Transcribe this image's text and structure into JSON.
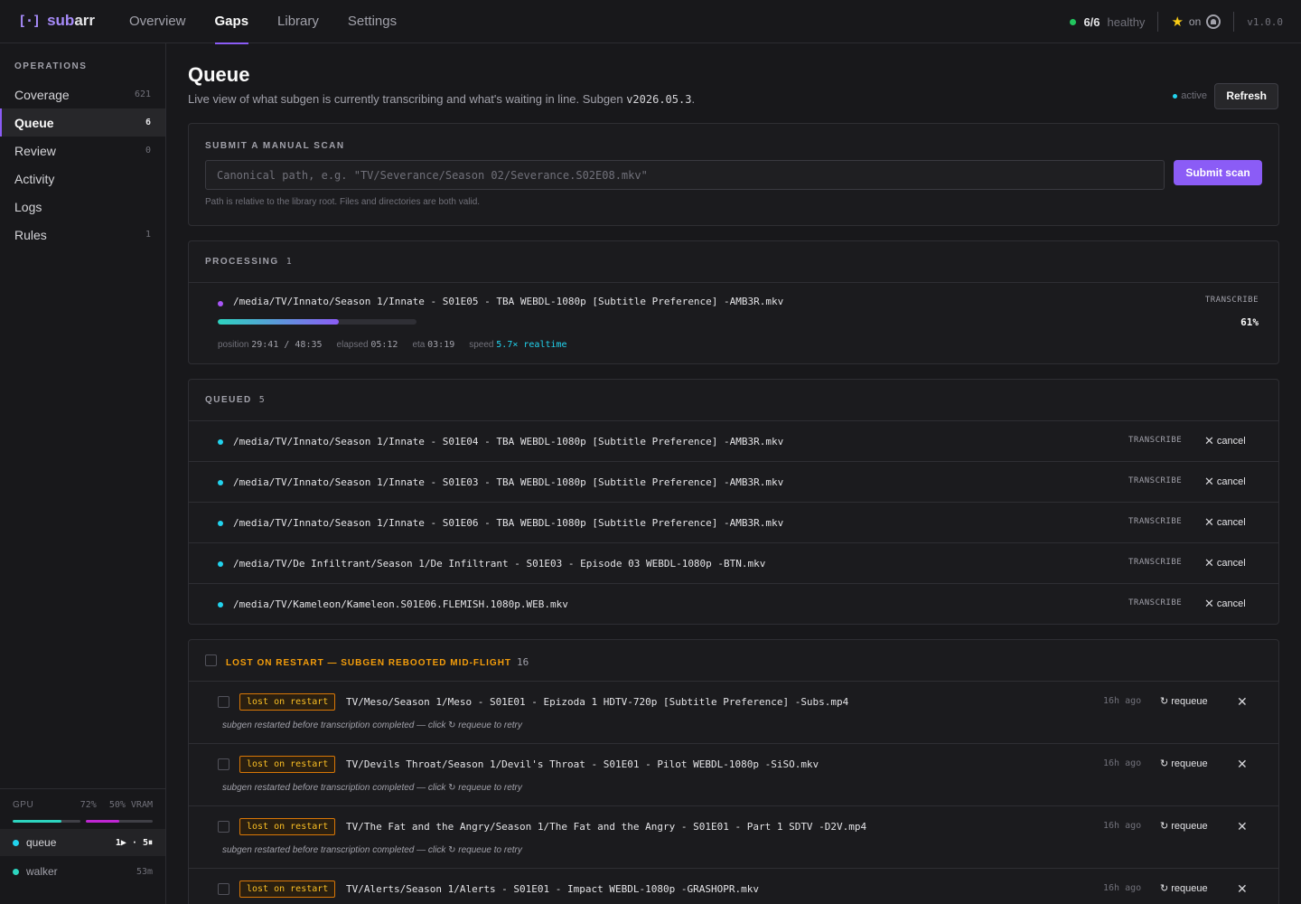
{
  "brand": {
    "mark": "[·]",
    "name_prefix": "sub",
    "name_suffix": "arr"
  },
  "nav": {
    "items": [
      {
        "label": "Overview"
      },
      {
        "label": "Gaps",
        "active": true
      },
      {
        "label": "Library"
      },
      {
        "label": "Settings"
      }
    ]
  },
  "header": {
    "health_count": "6/6",
    "health_label": "healthy",
    "star_label": "on",
    "version": "v1.0.0"
  },
  "sidebar": {
    "section_title": "OPERATIONS",
    "items": [
      {
        "label": "Coverage",
        "count": "621"
      },
      {
        "label": "Queue",
        "count": "6",
        "active": true
      },
      {
        "label": "Review",
        "count": "0"
      },
      {
        "label": "Activity",
        "count": ""
      },
      {
        "label": "Logs",
        "count": ""
      },
      {
        "label": "Rules",
        "count": "1"
      }
    ],
    "gpu": {
      "label": "GPU",
      "gpu_pct": "72%",
      "vram_label": "50% VRAM",
      "gpu_fill": 0.72,
      "vram_fill": 0.5
    },
    "workers": [
      {
        "name": "queue",
        "status": "1▶ · 5⏸"
      },
      {
        "name": "walker",
        "status": "53m"
      }
    ]
  },
  "page": {
    "title": "Queue",
    "subtitle_text": "Live view of what subgen is currently transcribing and what's waiting in line. Subgen ",
    "subtitle_version": "v2026.05.3",
    "subtitle_end": ".",
    "status": "active",
    "refresh_label": "Refresh"
  },
  "scan": {
    "title": "SUBMIT A MANUAL SCAN",
    "placeholder": "Canonical path, e.g. \"TV/Severance/Season 02/Severance.S02E08.mkv\"",
    "button": "Submit scan",
    "help": "Path is relative to the library root. Files and directories are both valid."
  },
  "processing": {
    "title": "PROCESSING",
    "count": "1",
    "item": {
      "path": "/media/TV/Innato/Season 1/Innate - S01E05 - TBA WEBDL-1080p [Subtitle Preference] -AMB3R.mkv",
      "kind": "TRANSCRIBE",
      "percent": "61%",
      "progress": 0.61,
      "position_label": "position",
      "position": "29:41 / 48:35",
      "elapsed_label": "elapsed",
      "elapsed": "05:12",
      "eta_label": "eta",
      "eta": "03:19",
      "speed_label": "speed",
      "speed": "5.7× realtime"
    }
  },
  "queued": {
    "title": "QUEUED",
    "count": "5",
    "cancel_label": "cancel",
    "items": [
      {
        "path": "/media/TV/Innato/Season 1/Innate - S01E04 - TBA WEBDL-1080p [Subtitle Preference] -AMB3R.mkv",
        "kind": "TRANSCRIBE"
      },
      {
        "path": "/media/TV/Innato/Season 1/Innate - S01E03 - TBA WEBDL-1080p [Subtitle Preference] -AMB3R.mkv",
        "kind": "TRANSCRIBE"
      },
      {
        "path": "/media/TV/Innato/Season 1/Innate - S01E06 - TBA WEBDL-1080p [Subtitle Preference] -AMB3R.mkv",
        "kind": "TRANSCRIBE"
      },
      {
        "path": "/media/TV/De Infiltrant/Season 1/De Infiltrant - S01E03 - Episode 03 WEBDL-1080p -BTN.mkv",
        "kind": "TRANSCRIBE"
      },
      {
        "path": "/media/TV/Kameleon/Kameleon.S01E06.FLEMISH.1080p.WEB.mkv",
        "kind": "TRANSCRIBE"
      }
    ]
  },
  "lost": {
    "title": "LOST ON RESTART — SUBGEN REBOOTED MID-FLIGHT",
    "count": "16",
    "badge": "lost on restart",
    "note": "subgen restarted before transcription completed — click ↻ requeue to retry",
    "requeue_label": "↻ requeue",
    "items": [
      {
        "path": "TV/Meso/Season 1/Meso - S01E01 - Epizoda 1 HDTV-720p [Subtitle Preference] -Subs.mp4",
        "ago": "16h ago"
      },
      {
        "path": "TV/Devils Throat/Season 1/Devil's Throat - S01E01 - Pilot WEBDL-1080p -SiSO.mkv",
        "ago": "16h ago"
      },
      {
        "path": "TV/The Fat and the Angry/Season 1/The Fat and the Angry - S01E01 - Part 1 SDTV -D2V.mp4",
        "ago": "16h ago"
      },
      {
        "path": "TV/Alerts/Season 1/Alerts - S01E01 - Impact WEBDL-1080p -GRASHOPR.mkv",
        "ago": "16h ago"
      }
    ]
  },
  "colors": {
    "accent": "#8b5cf6",
    "queued_dot": "#22d3ee",
    "processing_dot": "#a855f7",
    "warning": "#f59e0b"
  }
}
